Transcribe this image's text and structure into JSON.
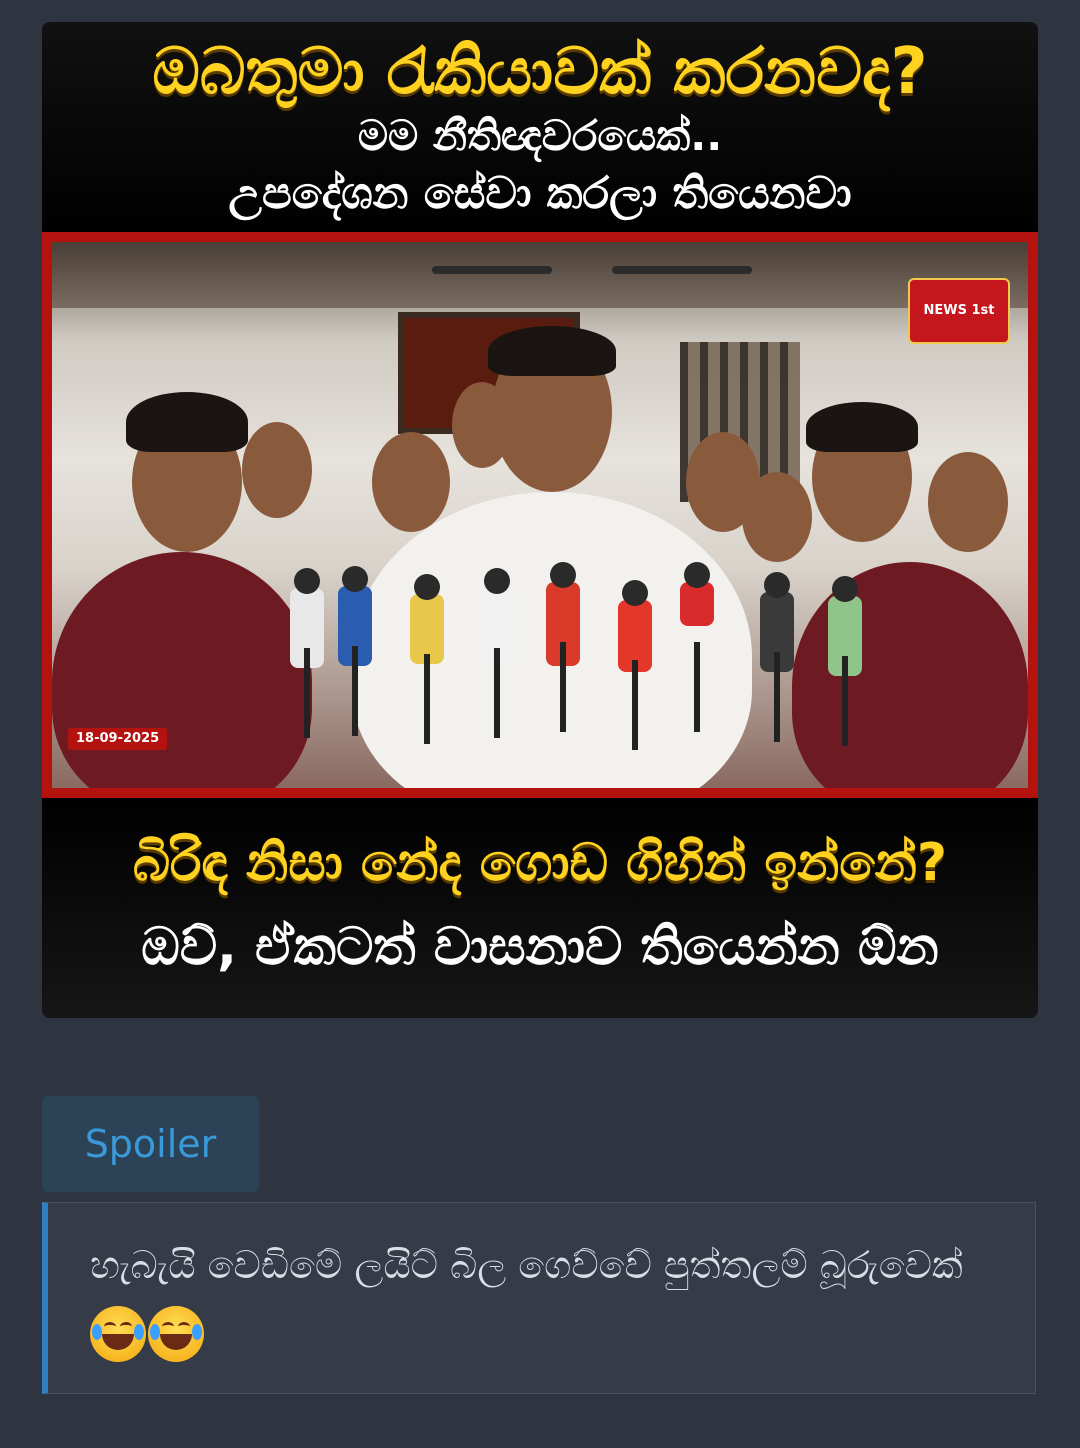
{
  "post": {
    "headline_top": {
      "line1": "ඔබතුමා රැකියාවක් කරනවද?",
      "line2": "මම නීතිඥවරයෙක්..",
      "line3": "උපදේශන සේවා කරලා තියෙනවා"
    },
    "headline_bottom": {
      "line1": "බිරිඳ නිසා නේද ගොඩ ගිහින් ඉන්නේ?",
      "line2": "ඔව්, ඒකටත් වාසනාව තියෙන්න ඕන"
    },
    "photo": {
      "channel_logo": "NEWS 1st",
      "date": "18-09-2025"
    }
  },
  "spoiler": {
    "button_label": "Spoiler",
    "text": "හැබැයි වෙඩිමේ ලයිට් බිල ගෙව්වේ පුත්තලම් බූරුවෙක්",
    "emoji": [
      "face-with-tears-of-joy",
      "face-with-tears-of-joy"
    ]
  },
  "colors": {
    "background": "#2e3440",
    "headline_yellow": "#ffd21f",
    "frame_red": "#b3120f",
    "spoiler_accent": "#2f7fc1",
    "spoiler_label": "#3a9ad9"
  }
}
